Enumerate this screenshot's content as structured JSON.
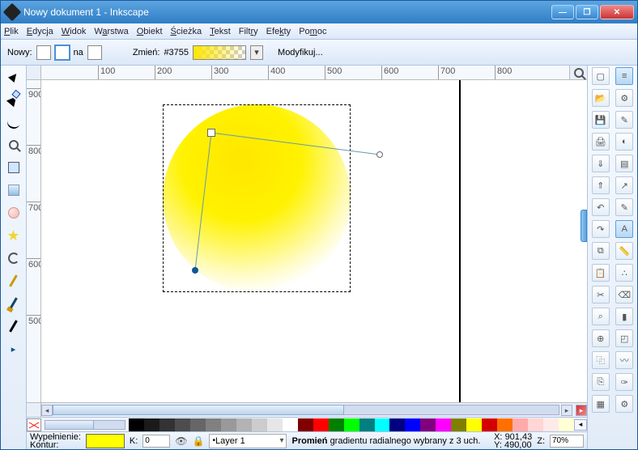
{
  "window": {
    "title": "Nowy dokument 1 - Inkscape"
  },
  "menu": {
    "file": "Plik",
    "edit": "Edycja",
    "view": "Widok",
    "layer": "Warstwa",
    "object": "Obiekt",
    "path": "Ścieżka",
    "text": "Tekst",
    "filters": "Filtry",
    "effects": "Efekty",
    "help": "Pomoc"
  },
  "tool_options": {
    "new_label": "Nowy:",
    "na_label": "na",
    "change_label": "Zmień:",
    "gradient_id": "#3755",
    "modify_label": "Modyfikuj..."
  },
  "ruler": {
    "h": [
      "100",
      "200",
      "300",
      "400",
      "500",
      "600",
      "700",
      "800"
    ],
    "v": [
      "900",
      "800",
      "700",
      "600",
      "500"
    ]
  },
  "right_toolbar": {
    "col1": [
      "new-doc",
      "open",
      "save",
      "print",
      "import",
      "export",
      "undo",
      "redo",
      "copy",
      "paste",
      "cut",
      "find",
      "zoom",
      "duplicate",
      "clone",
      "group"
    ],
    "col2": [
      "xml-editor",
      "doc-props",
      "node-edit",
      "paint-sel",
      "gradient-sel",
      "connector",
      "dropper",
      "text-tool",
      "measure",
      "spray",
      "eraser",
      "bucket",
      "3dbox",
      "tweak",
      "calligraphy",
      "prefs"
    ]
  },
  "palette": [
    "#000000",
    "#1a1a1a",
    "#333333",
    "#4d4d4d",
    "#666666",
    "#808080",
    "#999999",
    "#b3b3b3",
    "#cccccc",
    "#e6e6e6",
    "#ffffff",
    "#800000",
    "#ff0000",
    "#008000",
    "#00ff00",
    "#008080",
    "#00ffff",
    "#000080",
    "#0000ff",
    "#800080",
    "#ff00ff",
    "#808000",
    "#ffff00",
    "#d40000",
    "#ff6f00",
    "#ffaaaa",
    "#ffd5d5",
    "#ffeaea",
    "#ffffd5"
  ],
  "status": {
    "fill_label": "Wypełnienie:",
    "stroke_label": "Kontur:",
    "stroke_value": "",
    "opacity_label": "K:",
    "opacity_value": "0",
    "layer": "Layer 1",
    "hint_prefix": "Promień ",
    "hint_rest": "gradientu radialnego wybrany z 3 uch.",
    "x_label": "X:",
    "x_value": "901,43",
    "y_label": "Y:",
    "y_value": "490,00",
    "z_label": "Z:",
    "z_value": "70%"
  }
}
